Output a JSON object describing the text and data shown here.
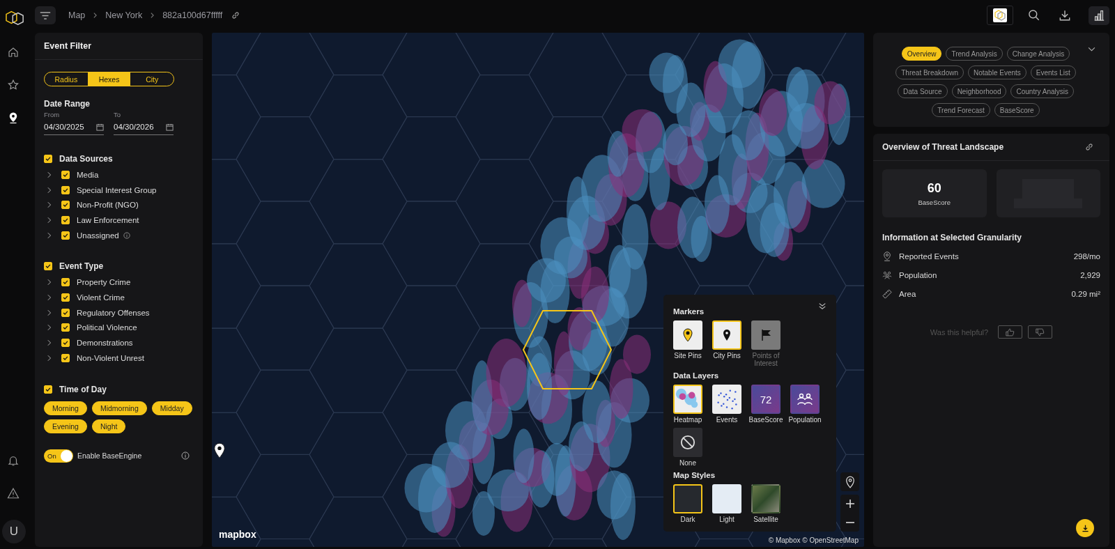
{
  "sidebar": {
    "user_initial": "U"
  },
  "breadcrumb": [
    "Map",
    "New York",
    "882a100d67fffff"
  ],
  "event_filter": {
    "title": "Event Filter",
    "modes": [
      {
        "label": "Radius",
        "selected": false
      },
      {
        "label": "Hexes",
        "selected": true
      },
      {
        "label": "City",
        "selected": false
      }
    ],
    "date_range": {
      "title": "Date Range",
      "from": {
        "label": "From",
        "value": "04/30/2025"
      },
      "to": {
        "label": "To",
        "value": "04/30/2026"
      }
    },
    "groups": [
      {
        "title": "Data Sources",
        "checked": true,
        "items": [
          {
            "label": "Media",
            "checked": true,
            "info": false
          },
          {
            "label": "Special Interest Group",
            "checked": true,
            "info": false
          },
          {
            "label": "Non-Profit (NGO)",
            "checked": true,
            "info": false
          },
          {
            "label": "Law Enforcement",
            "checked": true,
            "info": false
          },
          {
            "label": "Unassigned",
            "checked": true,
            "info": true
          }
        ]
      },
      {
        "title": "Event Type",
        "checked": true,
        "items": [
          {
            "label": "Property Crime",
            "checked": true,
            "info": false
          },
          {
            "label": "Violent Crime",
            "checked": true,
            "info": false
          },
          {
            "label": "Regulatory Offenses",
            "checked": true,
            "info": false
          },
          {
            "label": "Political Violence",
            "checked": true,
            "info": false
          },
          {
            "label": "Demonstrations",
            "checked": true,
            "info": false
          },
          {
            "label": "Non-Violent Unrest",
            "checked": true,
            "info": false
          }
        ]
      }
    ],
    "time_of_day": {
      "title": "Time of Day",
      "checked": true,
      "slots": [
        {
          "label": "Morning",
          "selected": true
        },
        {
          "label": "Midmorning",
          "selected": true
        },
        {
          "label": "Midday",
          "selected": true
        },
        {
          "label": "Evening",
          "selected": true
        },
        {
          "label": "Night",
          "selected": true
        }
      ]
    },
    "base_engine": {
      "state_label": "On",
      "on": true,
      "label": "Enable BaseEngine"
    }
  },
  "map": {
    "logo": "mapbox",
    "attribution": "© Mapbox © OpenStreetMap",
    "layers_panel": {
      "sections": [
        {
          "title": "Markers",
          "options": [
            {
              "kind": "site-pins",
              "label": "Site Pins",
              "selected": false,
              "disabled": false
            },
            {
              "kind": "city-pins",
              "label": "City Pins",
              "selected": true,
              "disabled": false
            },
            {
              "kind": "poi",
              "label": "Points of Interest",
              "selected": false,
              "disabled": true
            }
          ]
        },
        {
          "title": "Data Layers",
          "options": [
            {
              "kind": "heatmap",
              "label": "Heatmap",
              "selected": true,
              "disabled": false
            },
            {
              "kind": "events",
              "label": "Events",
              "selected": false,
              "disabled": false
            },
            {
              "kind": "basescore",
              "label": "BaseScore",
              "badge": "72",
              "selected": false,
              "disabled": false
            },
            {
              "kind": "population",
              "label": "Population",
              "selected": false,
              "disabled": false
            },
            {
              "kind": "none",
              "label": "None",
              "selected": false,
              "disabled": false
            }
          ]
        },
        {
          "title": "Map Styles",
          "options": [
            {
              "kind": "dark",
              "label": "Dark",
              "selected": true,
              "disabled": false
            },
            {
              "kind": "light",
              "label": "Light",
              "selected": false,
              "disabled": false
            },
            {
              "kind": "satellite",
              "label": "Satellite",
              "selected": false,
              "disabled": false
            }
          ]
        }
      ]
    }
  },
  "analysis": {
    "tabs": [
      {
        "label": "Overview",
        "selected": true
      },
      {
        "label": "Trend Analysis",
        "selected": false
      },
      {
        "label": "Change Analysis",
        "selected": false
      },
      {
        "label": "Threat Breakdown",
        "selected": false
      },
      {
        "label": "Notable Events",
        "selected": false
      },
      {
        "label": "Events List",
        "selected": false
      },
      {
        "label": "Data Source",
        "selected": false
      },
      {
        "label": "Neighborhood",
        "selected": false
      },
      {
        "label": "Country Analysis",
        "selected": false
      },
      {
        "label": "Trend Forecast",
        "selected": false
      },
      {
        "label": "BaseScore",
        "selected": false
      }
    ],
    "card": {
      "title": "Overview of Threat Landscape",
      "score": "60",
      "score_label": "BaseScore",
      "info_title": "Information at Selected Granularity",
      "rows": [
        {
          "kind": "events",
          "label": "Reported Events",
          "value": "298/mo"
        },
        {
          "kind": "population",
          "label": "Population",
          "value": "2,929"
        },
        {
          "kind": "area",
          "label": "Area",
          "value": "0.29 mi²"
        }
      ],
      "feedback": "Was this helpful?"
    }
  }
}
